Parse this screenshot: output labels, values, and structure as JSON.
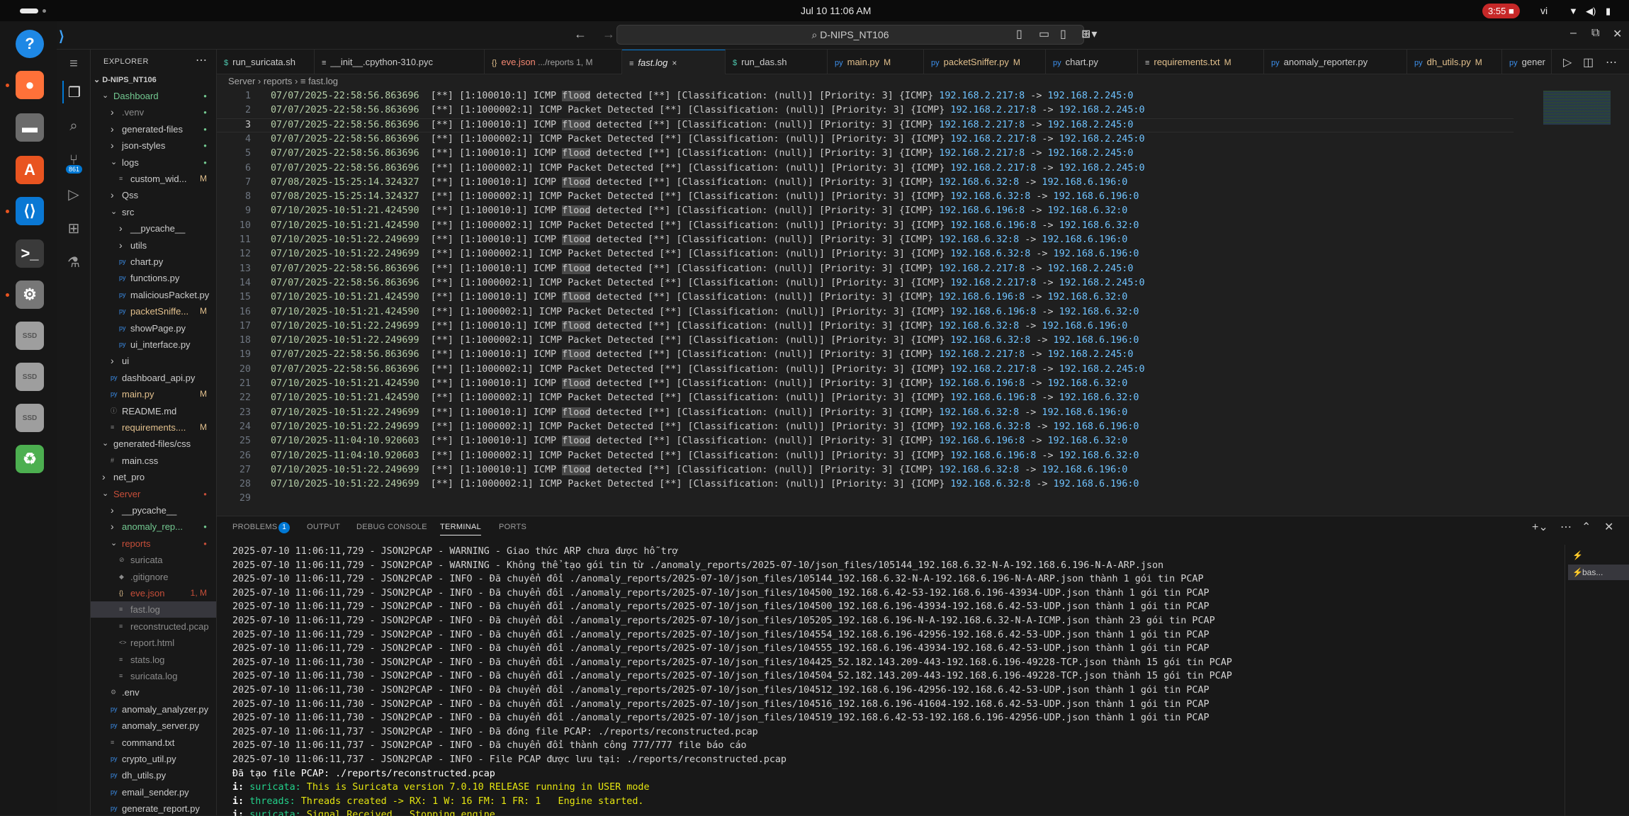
{
  "system_bar": {
    "clock": "Jul 10  11:06 AM",
    "recording": "3:55",
    "lang": "vi"
  },
  "dock": {
    "items": [
      {
        "name": "help-icon",
        "glyph": "?",
        "color": "#1e88e5"
      },
      {
        "name": "firefox-icon",
        "glyph": "●",
        "color": "#ff7139"
      },
      {
        "name": "files-icon",
        "glyph": "▬",
        "color": "#6b6b6b"
      },
      {
        "name": "app-center-icon",
        "glyph": "A",
        "color": "#e95420"
      },
      {
        "name": "vscode-icon",
        "glyph": "⟨⟩",
        "color": "#0a78d4"
      },
      {
        "name": "terminal-icon",
        "glyph": ">_",
        "color": "#3a3a3a"
      },
      {
        "name": "settings-icon",
        "glyph": "⚙",
        "color": "#777777"
      },
      {
        "name": "drive-icon",
        "glyph": "SSD",
        "color": "#9e9e9e"
      },
      {
        "name": "drive-icon",
        "glyph": "SSD",
        "color": "#9e9e9e"
      },
      {
        "name": "drive-icon",
        "glyph": "SSD",
        "color": "#9e9e9e"
      },
      {
        "name": "trash-icon",
        "glyph": "♻",
        "color": "#4caf50"
      }
    ]
  },
  "titlebar": {
    "command_center": "D-NIPS_NT106"
  },
  "activity": {
    "scm_badge": "861"
  },
  "explorer": {
    "title": "EXPLORER",
    "root": "D-NIPS_NT106",
    "rows": [
      {
        "label": "Dashboard",
        "indent": 1,
        "type": "folder-open",
        "color": "#73c991"
      },
      {
        "label": ".venv",
        "indent": 2,
        "type": "folder",
        "color": "#8c8c8c"
      },
      {
        "label": "generated-files",
        "indent": 2,
        "type": "folder",
        "color": "#cccccc"
      },
      {
        "label": "json-styles",
        "indent": 2,
        "type": "folder",
        "color": "#cccccc"
      },
      {
        "label": "logs",
        "indent": 2,
        "type": "folder-open",
        "color": "#cccccc"
      },
      {
        "label": "custom_wid...",
        "indent": 3,
        "type": "file",
        "color": "#cccccc",
        "badge": "M",
        "icon": "≡"
      },
      {
        "label": "Qss",
        "indent": 2,
        "type": "folder",
        "color": "#cccccc"
      },
      {
        "label": "src",
        "indent": 2,
        "type": "folder-open",
        "color": "#cccccc"
      },
      {
        "label": "__pycache__",
        "indent": 3,
        "type": "folder",
        "color": "#cccccc"
      },
      {
        "label": "utils",
        "indent": 3,
        "type": "folder",
        "color": "#cccccc"
      },
      {
        "label": "chart.py",
        "indent": 3,
        "type": "file",
        "color": "#cccccc",
        "icon": "py"
      },
      {
        "label": "functions.py",
        "indent": 3,
        "type": "file",
        "color": "#cccccc",
        "icon": "py"
      },
      {
        "label": "maliciousPacket.py",
        "indent": 3,
        "type": "file",
        "color": "#cccccc",
        "icon": "py"
      },
      {
        "label": "packetSniffe...",
        "indent": 3,
        "type": "file",
        "color": "#e2c08d",
        "badge": "M",
        "icon": "py"
      },
      {
        "label": "showPage.py",
        "indent": 3,
        "type": "file",
        "color": "#cccccc",
        "icon": "py"
      },
      {
        "label": "ui_interface.py",
        "indent": 3,
        "type": "file",
        "color": "#cccccc",
        "icon": "py"
      },
      {
        "label": "ui",
        "indent": 2,
        "type": "folder",
        "color": "#cccccc"
      },
      {
        "label": "dashboard_api.py",
        "indent": 2,
        "type": "file",
        "color": "#cccccc",
        "icon": "py"
      },
      {
        "label": "main.py",
        "indent": 2,
        "type": "file",
        "color": "#e2c08d",
        "badge": "M",
        "icon": "py"
      },
      {
        "label": "README.md",
        "indent": 2,
        "type": "file",
        "color": "#cccccc",
        "icon": "ⓘ"
      },
      {
        "label": "requirements....",
        "indent": 2,
        "type": "file",
        "color": "#e2c08d",
        "badge": "M",
        "icon": "≡"
      },
      {
        "label": "generated-files/css",
        "indent": 1,
        "type": "folder-open",
        "color": "#cccccc"
      },
      {
        "label": "main.css",
        "indent": 2,
        "type": "file",
        "color": "#cccccc",
        "icon": "#"
      },
      {
        "label": "net_pro",
        "indent": 1,
        "type": "folder",
        "color": "#cccccc"
      },
      {
        "label": "Server",
        "indent": 1,
        "type": "folder-open",
        "color": "#c74e39"
      },
      {
        "label": "__pycache__",
        "indent": 2,
        "type": "folder",
        "color": "#cccccc"
      },
      {
        "label": "anomaly_rep...",
        "indent": 2,
        "type": "folder",
        "color": "#73c991"
      },
      {
        "label": "reports",
        "indent": 2,
        "type": "folder-open",
        "color": "#c74e39"
      },
      {
        "label": "suricata",
        "indent": 3,
        "type": "file",
        "color": "#8c8c8c",
        "icon": "⊘"
      },
      {
        "label": ".gitignore",
        "indent": 3,
        "type": "file",
        "color": "#8c8c8c",
        "icon": "◆"
      },
      {
        "label": "eve.json",
        "indent": 3,
        "type": "file",
        "color": "#c74e39",
        "badge": "1, M",
        "icon": "{}"
      },
      {
        "label": "fast.log",
        "indent": 3,
        "type": "file",
        "color": "#8c8c8c",
        "icon": "≡",
        "selected": true
      },
      {
        "label": "reconstructed.pcap",
        "indent": 3,
        "type": "file",
        "color": "#8c8c8c",
        "icon": "≡"
      },
      {
        "label": "report.html",
        "indent": 3,
        "type": "file",
        "color": "#8c8c8c",
        "icon": "<>"
      },
      {
        "label": "stats.log",
        "indent": 3,
        "type": "file",
        "color": "#8c8c8c",
        "icon": "≡"
      },
      {
        "label": "suricata.log",
        "indent": 3,
        "type": "file",
        "color": "#8c8c8c",
        "icon": "≡"
      },
      {
        "label": ".env",
        "indent": 2,
        "type": "file",
        "color": "#cccccc",
        "icon": "⚙"
      },
      {
        "label": "anomaly_analyzer.py",
        "indent": 2,
        "type": "file",
        "color": "#cccccc",
        "icon": "py"
      },
      {
        "label": "anomaly_server.py",
        "indent": 2,
        "type": "file",
        "color": "#cccccc",
        "icon": "py"
      },
      {
        "label": "command.txt",
        "indent": 2,
        "type": "file",
        "color": "#cccccc",
        "icon": "≡"
      },
      {
        "label": "crypto_util.py",
        "indent": 2,
        "type": "file",
        "color": "#cccccc",
        "icon": "py"
      },
      {
        "label": "dh_utils.py",
        "indent": 2,
        "type": "file",
        "color": "#cccccc",
        "icon": "py"
      },
      {
        "label": "email_sender.py",
        "indent": 2,
        "type": "file",
        "color": "#cccccc",
        "icon": "py"
      },
      {
        "label": "generate_report.py",
        "indent": 2,
        "type": "file",
        "color": "#cccccc",
        "icon": "py"
      }
    ]
  },
  "tabs": [
    {
      "label": "run_suricata.sh",
      "icon": "$",
      "icon_color": "#4ec9b0",
      "color": "#cccccc",
      "status": ""
    },
    {
      "label": "__init__.cpython-310.pyc",
      "icon": "≡",
      "icon_color": "#cccccc",
      "color": "#cccccc",
      "status": ""
    },
    {
      "label": "eve.json",
      "suffix": " .../reports 1, M",
      "icon": "{}",
      "icon_color": "#e2c08d",
      "color": "#f48771",
      "status": ""
    },
    {
      "label": "fast.log",
      "icon": "≡",
      "icon_color": "#cccccc",
      "color": "#e7e7e7",
      "status": "×",
      "active": true
    },
    {
      "label": "run_das.sh",
      "icon": "$",
      "icon_color": "#4ec9b0",
      "color": "#cccccc",
      "status": ""
    },
    {
      "label": "main.py",
      "icon": "py",
      "icon_color": "#3b8eea",
      "color": "#e2c08d",
      "status": "M"
    },
    {
      "label": "packetSniffer.py",
      "icon": "py",
      "icon_color": "#3b8eea",
      "color": "#e2c08d",
      "status": "M"
    },
    {
      "label": "chart.py",
      "icon": "py",
      "icon_color": "#3b8eea",
      "color": "#cccccc",
      "status": ""
    },
    {
      "label": "requirements.txt",
      "icon": "≡",
      "icon_color": "#cccccc",
      "color": "#e2c08d",
      "status": "M"
    },
    {
      "label": "anomaly_reporter.py",
      "icon": "py",
      "icon_color": "#3b8eea",
      "color": "#cccccc",
      "status": ""
    },
    {
      "label": "dh_utils.py",
      "icon": "py",
      "icon_color": "#3b8eea",
      "color": "#e2c08d",
      "status": "M"
    },
    {
      "label": "gener",
      "icon": "py",
      "icon_color": "#3b8eea",
      "color": "#cccccc",
      "status": ""
    }
  ],
  "breadcrumb": [
    "Server",
    "reports",
    "fast.log"
  ],
  "editor": {
    "lines": [
      {
        "n": "1",
        "ts": "07/07/2025-22:58:56.863696",
        "sid": "1:100010:1",
        "msg": "ICMP flood detected",
        "src": "192.168.2.217:8",
        "dst": "192.168.2.245:0"
      },
      {
        "n": "2",
        "ts": "07/07/2025-22:58:56.863696",
        "sid": "1:1000002:1",
        "msg": "ICMP Packet Detected",
        "src": "192.168.2.217:8",
        "dst": "192.168.2.245:0"
      },
      {
        "n": "3",
        "ts": "07/07/2025-22:58:56.863696",
        "sid": "1:100010:1",
        "msg": "ICMP flood detected",
        "src": "192.168.2.217:8",
        "dst": "192.168.2.245:0"
      },
      {
        "n": "4",
        "ts": "07/07/2025-22:58:56.863696",
        "sid": "1:1000002:1",
        "msg": "ICMP Packet Detected",
        "src": "192.168.2.217:8",
        "dst": "192.168.2.245:0"
      },
      {
        "n": "5",
        "ts": "07/07/2025-22:58:56.863696",
        "sid": "1:100010:1",
        "msg": "ICMP flood detected",
        "src": "192.168.2.217:8",
        "dst": "192.168.2.245:0"
      },
      {
        "n": "6",
        "ts": "07/07/2025-22:58:56.863696",
        "sid": "1:1000002:1",
        "msg": "ICMP Packet Detected",
        "src": "192.168.2.217:8",
        "dst": "192.168.2.245:0"
      },
      {
        "n": "7",
        "ts": "07/08/2025-15:25:14.324327",
        "sid": "1:100010:1",
        "msg": "ICMP flood detected",
        "src": "192.168.6.32:8",
        "dst": "192.168.6.196:0"
      },
      {
        "n": "8",
        "ts": "07/08/2025-15:25:14.324327",
        "sid": "1:1000002:1",
        "msg": "ICMP Packet Detected",
        "src": "192.168.6.32:8",
        "dst": "192.168.6.196:0"
      },
      {
        "n": "9",
        "ts": "07/10/2025-10:51:21.424590",
        "sid": "1:100010:1",
        "msg": "ICMP flood detected",
        "src": "192.168.6.196:8",
        "dst": "192.168.6.32:0"
      },
      {
        "n": "10",
        "ts": "07/10/2025-10:51:21.424590",
        "sid": "1:1000002:1",
        "msg": "ICMP Packet Detected",
        "src": "192.168.6.196:8",
        "dst": "192.168.6.32:0"
      },
      {
        "n": "11",
        "ts": "07/10/2025-10:51:22.249699",
        "sid": "1:100010:1",
        "msg": "ICMP flood detected",
        "src": "192.168.6.32:8",
        "dst": "192.168.6.196:0"
      },
      {
        "n": "12",
        "ts": "07/10/2025-10:51:22.249699",
        "sid": "1:1000002:1",
        "msg": "ICMP Packet Detected",
        "src": "192.168.6.32:8",
        "dst": "192.168.6.196:0"
      },
      {
        "n": "13",
        "ts": "07/07/2025-22:58:56.863696",
        "sid": "1:100010:1",
        "msg": "ICMP flood detected",
        "src": "192.168.2.217:8",
        "dst": "192.168.2.245:0"
      },
      {
        "n": "14",
        "ts": "07/07/2025-22:58:56.863696",
        "sid": "1:1000002:1",
        "msg": "ICMP Packet Detected",
        "src": "192.168.2.217:8",
        "dst": "192.168.2.245:0"
      },
      {
        "n": "15",
        "ts": "07/10/2025-10:51:21.424590",
        "sid": "1:100010:1",
        "msg": "ICMP flood detected",
        "src": "192.168.6.196:8",
        "dst": "192.168.6.32:0"
      },
      {
        "n": "16",
        "ts": "07/10/2025-10:51:21.424590",
        "sid": "1:1000002:1",
        "msg": "ICMP Packet Detected",
        "src": "192.168.6.196:8",
        "dst": "192.168.6.32:0"
      },
      {
        "n": "17",
        "ts": "07/10/2025-10:51:22.249699",
        "sid": "1:100010:1",
        "msg": "ICMP flood detected",
        "src": "192.168.6.32:8",
        "dst": "192.168.6.196:0"
      },
      {
        "n": "18",
        "ts": "07/10/2025-10:51:22.249699",
        "sid": "1:1000002:1",
        "msg": "ICMP Packet Detected",
        "src": "192.168.6.32:8",
        "dst": "192.168.6.196:0"
      },
      {
        "n": "19",
        "ts": "07/07/2025-22:58:56.863696",
        "sid": "1:100010:1",
        "msg": "ICMP flood detected",
        "src": "192.168.2.217:8",
        "dst": "192.168.2.245:0"
      },
      {
        "n": "20",
        "ts": "07/07/2025-22:58:56.863696",
        "sid": "1:1000002:1",
        "msg": "ICMP Packet Detected",
        "src": "192.168.2.217:8",
        "dst": "192.168.2.245:0"
      },
      {
        "n": "21",
        "ts": "07/10/2025-10:51:21.424590",
        "sid": "1:100010:1",
        "msg": "ICMP flood detected",
        "src": "192.168.6.196:8",
        "dst": "192.168.6.32:0"
      },
      {
        "n": "22",
        "ts": "07/10/2025-10:51:21.424590",
        "sid": "1:1000002:1",
        "msg": "ICMP Packet Detected",
        "src": "192.168.6.196:8",
        "dst": "192.168.6.32:0"
      },
      {
        "n": "23",
        "ts": "07/10/2025-10:51:22.249699",
        "sid": "1:100010:1",
        "msg": "ICMP flood detected",
        "src": "192.168.6.32:8",
        "dst": "192.168.6.196:0"
      },
      {
        "n": "24",
        "ts": "07/10/2025-10:51:22.249699",
        "sid": "1:1000002:1",
        "msg": "ICMP Packet Detected",
        "src": "192.168.6.32:8",
        "dst": "192.168.6.196:0"
      },
      {
        "n": "25",
        "ts": "07/10/2025-11:04:10.920603",
        "sid": "1:100010:1",
        "msg": "ICMP flood detected",
        "src": "192.168.6.196:8",
        "dst": "192.168.6.32:0"
      },
      {
        "n": "26",
        "ts": "07/10/2025-11:04:10.920603",
        "sid": "1:1000002:1",
        "msg": "ICMP Packet Detected",
        "src": "192.168.6.196:8",
        "dst": "192.168.6.32:0"
      },
      {
        "n": "27",
        "ts": "07/10/2025-10:51:22.249699",
        "sid": "1:100010:1",
        "msg": "ICMP flood detected",
        "src": "192.168.6.32:8",
        "dst": "192.168.6.196:0"
      },
      {
        "n": "28",
        "ts": "07/10/2025-10:51:22.249699",
        "sid": "1:1000002:1",
        "msg": "ICMP Packet Detected",
        "src": "192.168.6.32:8",
        "dst": "192.168.6.196:0"
      },
      {
        "n": "29",
        "ts": "",
        "sid": "",
        "msg": "",
        "src": "",
        "dst": ""
      }
    ]
  },
  "panel": {
    "tabs": [
      "PROBLEMS",
      "OUTPUT",
      "DEBUG CONSOLE",
      "TERMINAL",
      "PORTS"
    ],
    "problems_count": "1",
    "terminals": [
      "",
      "bas..."
    ],
    "lines": [
      {
        "text": "2025-07-10 11:06:11,729 - JSON2PCAP - WARNING - Giao thức ARP chưa được hỗ trợ",
        "type": "plain"
      },
      {
        "text": "2025-07-10 11:06:11,729 - JSON2PCAP - WARNING - Không thể tạo gói tin từ ./anomaly_reports/2025-07-10/json_files/105144_192.168.6.32-N-A-192.168.6.196-N-A-ARP.json",
        "type": "plain"
      },
      {
        "text": "2025-07-10 11:06:11,729 - JSON2PCAP - INFO - Đã chuyển đổi ./anomaly_reports/2025-07-10/json_files/105144_192.168.6.32-N-A-192.168.6.196-N-A-ARP.json thành 1 gói tin PCAP",
        "type": "plain"
      },
      {
        "text": "2025-07-10 11:06:11,729 - JSON2PCAP - INFO - Đã chuyển đổi ./anomaly_reports/2025-07-10/json_files/104500_192.168.6.42-53-192.168.6.196-43934-UDP.json thành 1 gói tin PCAP",
        "type": "plain"
      },
      {
        "text": "2025-07-10 11:06:11,729 - JSON2PCAP - INFO - Đã chuyển đổi ./anomaly_reports/2025-07-10/json_files/104500_192.168.6.196-43934-192.168.6.42-53-UDP.json thành 1 gói tin PCAP",
        "type": "plain"
      },
      {
        "text": "2025-07-10 11:06:11,729 - JSON2PCAP - INFO - Đã chuyển đổi ./anomaly_reports/2025-07-10/json_files/105205_192.168.6.196-N-A-192.168.6.32-N-A-ICMP.json thành 23 gói tin PCAP",
        "type": "plain"
      },
      {
        "text": "2025-07-10 11:06:11,729 - JSON2PCAP - INFO - Đã chuyển đổi ./anomaly_reports/2025-07-10/json_files/104554_192.168.6.196-42956-192.168.6.42-53-UDP.json thành 1 gói tin PCAP",
        "type": "plain"
      },
      {
        "text": "2025-07-10 11:06:11,729 - JSON2PCAP - INFO - Đã chuyển đổi ./anomaly_reports/2025-07-10/json_files/104555_192.168.6.196-43934-192.168.6.42-53-UDP.json thành 1 gói tin PCAP",
        "type": "plain"
      },
      {
        "text": "2025-07-10 11:06:11,730 - JSON2PCAP - INFO - Đã chuyển đổi ./anomaly_reports/2025-07-10/json_files/104425_52.182.143.209-443-192.168.6.196-49228-TCP.json thành 15 gói tin PCAP",
        "type": "plain"
      },
      {
        "text": "2025-07-10 11:06:11,730 - JSON2PCAP - INFO - Đã chuyển đổi ./anomaly_reports/2025-07-10/json_files/104504_52.182.143.209-443-192.168.6.196-49228-TCP.json thành 15 gói tin PCAP",
        "type": "plain"
      },
      {
        "text": "2025-07-10 11:06:11,730 - JSON2PCAP - INFO - Đã chuyển đổi ./anomaly_reports/2025-07-10/json_files/104512_192.168.6.196-42956-192.168.6.42-53-UDP.json thành 1 gói tin PCAP",
        "type": "plain"
      },
      {
        "text": "2025-07-10 11:06:11,730 - JSON2PCAP - INFO - Đã chuyển đổi ./anomaly_reports/2025-07-10/json_files/104516_192.168.6.196-41604-192.168.6.42-53-UDP.json thành 1 gói tin PCAP",
        "type": "plain"
      },
      {
        "text": "2025-07-10 11:06:11,730 - JSON2PCAP - INFO - Đã chuyển đổi ./anomaly_reports/2025-07-10/json_files/104519_192.168.6.42-53-192.168.6.196-42956-UDP.json thành 1 gói tin PCAP",
        "type": "plain"
      },
      {
        "text": "2025-07-10 11:06:11,737 - JSON2PCAP - INFO - Đã đóng file PCAP: ./reports/reconstructed.pcap",
        "type": "plain"
      },
      {
        "text": "2025-07-10 11:06:11,737 - JSON2PCAP - INFO - Đã chuyển đổi thành công 777/777 file báo cáo",
        "type": "plain"
      },
      {
        "text": "2025-07-10 11:06:11,737 - JSON2PCAP - INFO - File PCAP được lưu tại: ./reports/reconstructed.pcap",
        "type": "plain"
      },
      {
        "text": "Đã tạo file PCAP: ./reports/reconstructed.pcap",
        "type": "white"
      },
      {
        "prefix": "i: ",
        "key": "suricata:",
        "text": " This is Suricata version 7.0.10 RELEASE running in USER mode",
        "type": "suri"
      },
      {
        "prefix": "i: ",
        "key": "threads:",
        "text": " Threads created -> RX: 1 W: 16 FM: 1 FR: 1   Engine started.",
        "type": "suri"
      },
      {
        "prefix": "i: ",
        "key": "suricata:",
        "text": " Signal Received.  Stopping engine.",
        "type": "suri"
      }
    ]
  }
}
